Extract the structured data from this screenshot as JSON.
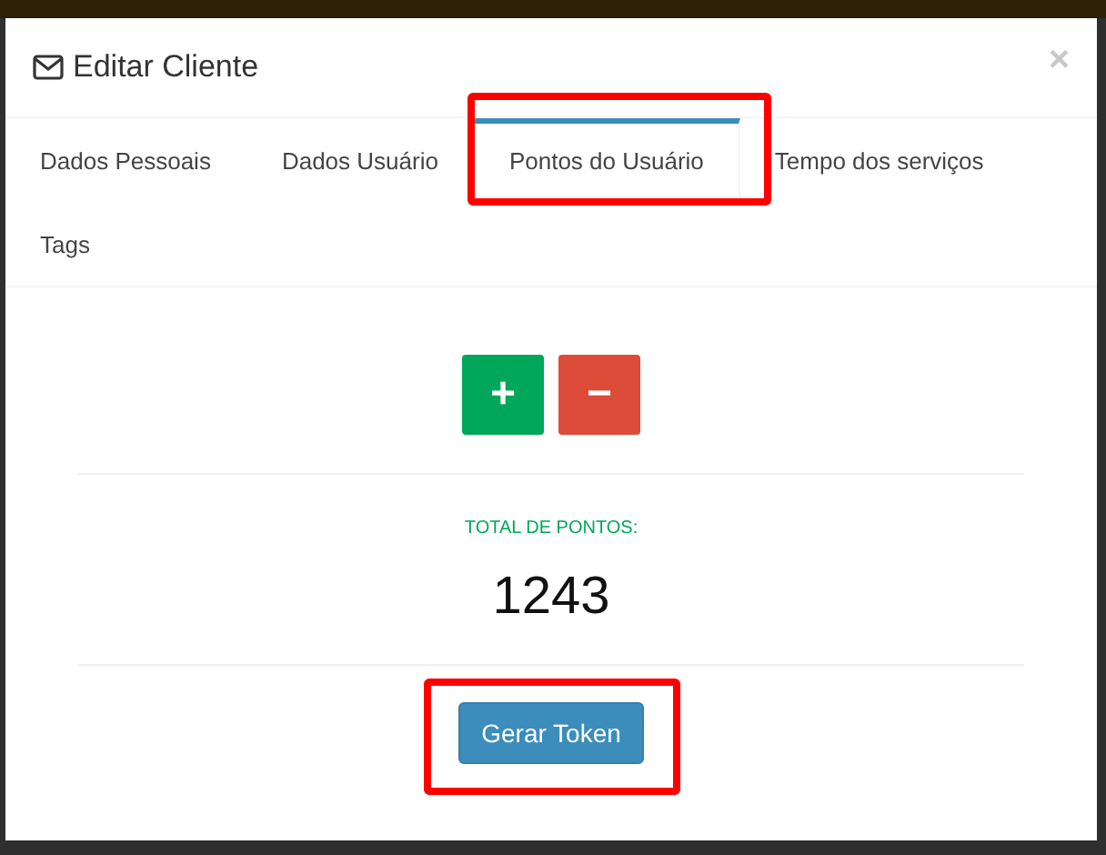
{
  "modal": {
    "title": "Editar Cliente",
    "close": "×"
  },
  "tabs": [
    {
      "label": "Dados Pessoais",
      "selected": false,
      "highlighted": false
    },
    {
      "label": "Dados Usuário",
      "selected": false,
      "highlighted": false
    },
    {
      "label": "Pontos do Usuário",
      "selected": true,
      "highlighted": true
    },
    {
      "label": "Tempo dos serviços",
      "selected": false,
      "highlighted": false
    },
    {
      "label": "Tags",
      "selected": false,
      "highlighted": false
    }
  ],
  "points": {
    "add_button": "+",
    "remove_button": "−",
    "total_label": "TOTAL DE PONTOS:",
    "total": "1243"
  },
  "token_button": {
    "label": "Gerar Token",
    "highlighted": true
  }
}
